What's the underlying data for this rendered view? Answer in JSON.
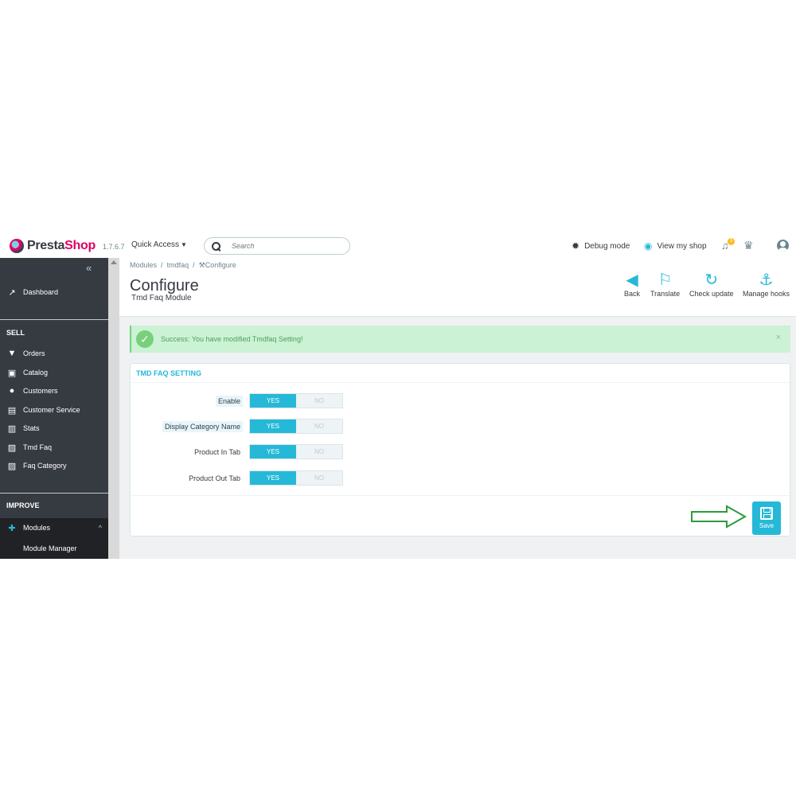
{
  "header": {
    "logo_prefix": "Presta",
    "logo_suffix": "Shop",
    "version": "1.7.6.7",
    "quick_access": "Quick Access",
    "search_placeholder": "Search",
    "debug_mode": "Debug mode",
    "view_shop": "View my shop",
    "notification_count": "3"
  },
  "sidebar": {
    "dashboard": "Dashboard",
    "sell_title": "SELL",
    "sell_items": [
      "Orders",
      "Catalog",
      "Customers",
      "Customer Service",
      "Stats",
      "Tmd Faq",
      "Faq Category"
    ],
    "improve_title": "IMPROVE",
    "modules": "Modules",
    "module_manager": "Module Manager"
  },
  "page": {
    "breadcrumb_1": "Modules",
    "breadcrumb_2": "tmdfaq",
    "breadcrumb_3": "Configure",
    "title": "Configure",
    "subtitle": "Tmd Faq Module"
  },
  "toolbar": {
    "back": "Back",
    "translate": "Translate",
    "check_update": "Check update",
    "manage_hooks": "Manage hooks"
  },
  "alert": {
    "text": "Success: You have modified Tmdfaq Setting!",
    "close": "×"
  },
  "panel": {
    "title": "TMD FAQ SETTING",
    "rows": [
      {
        "label": "Enable",
        "yes": "YES",
        "no": "NO",
        "value": "YES"
      },
      {
        "label": "Display Category Name",
        "yes": "YES",
        "no": "NO",
        "value": "YES"
      },
      {
        "label": "Product In Tab",
        "yes": "YES",
        "no": "NO",
        "value": "YES"
      },
      {
        "label": "Product Out Tab",
        "yes": "YES",
        "no": "NO",
        "value": "YES"
      }
    ],
    "save": "Save"
  },
  "colors": {
    "accent": "#25b9d7",
    "sidebar": "#363a41",
    "success_bg": "#cbf2d4",
    "arrow": "#2a9d3a"
  }
}
